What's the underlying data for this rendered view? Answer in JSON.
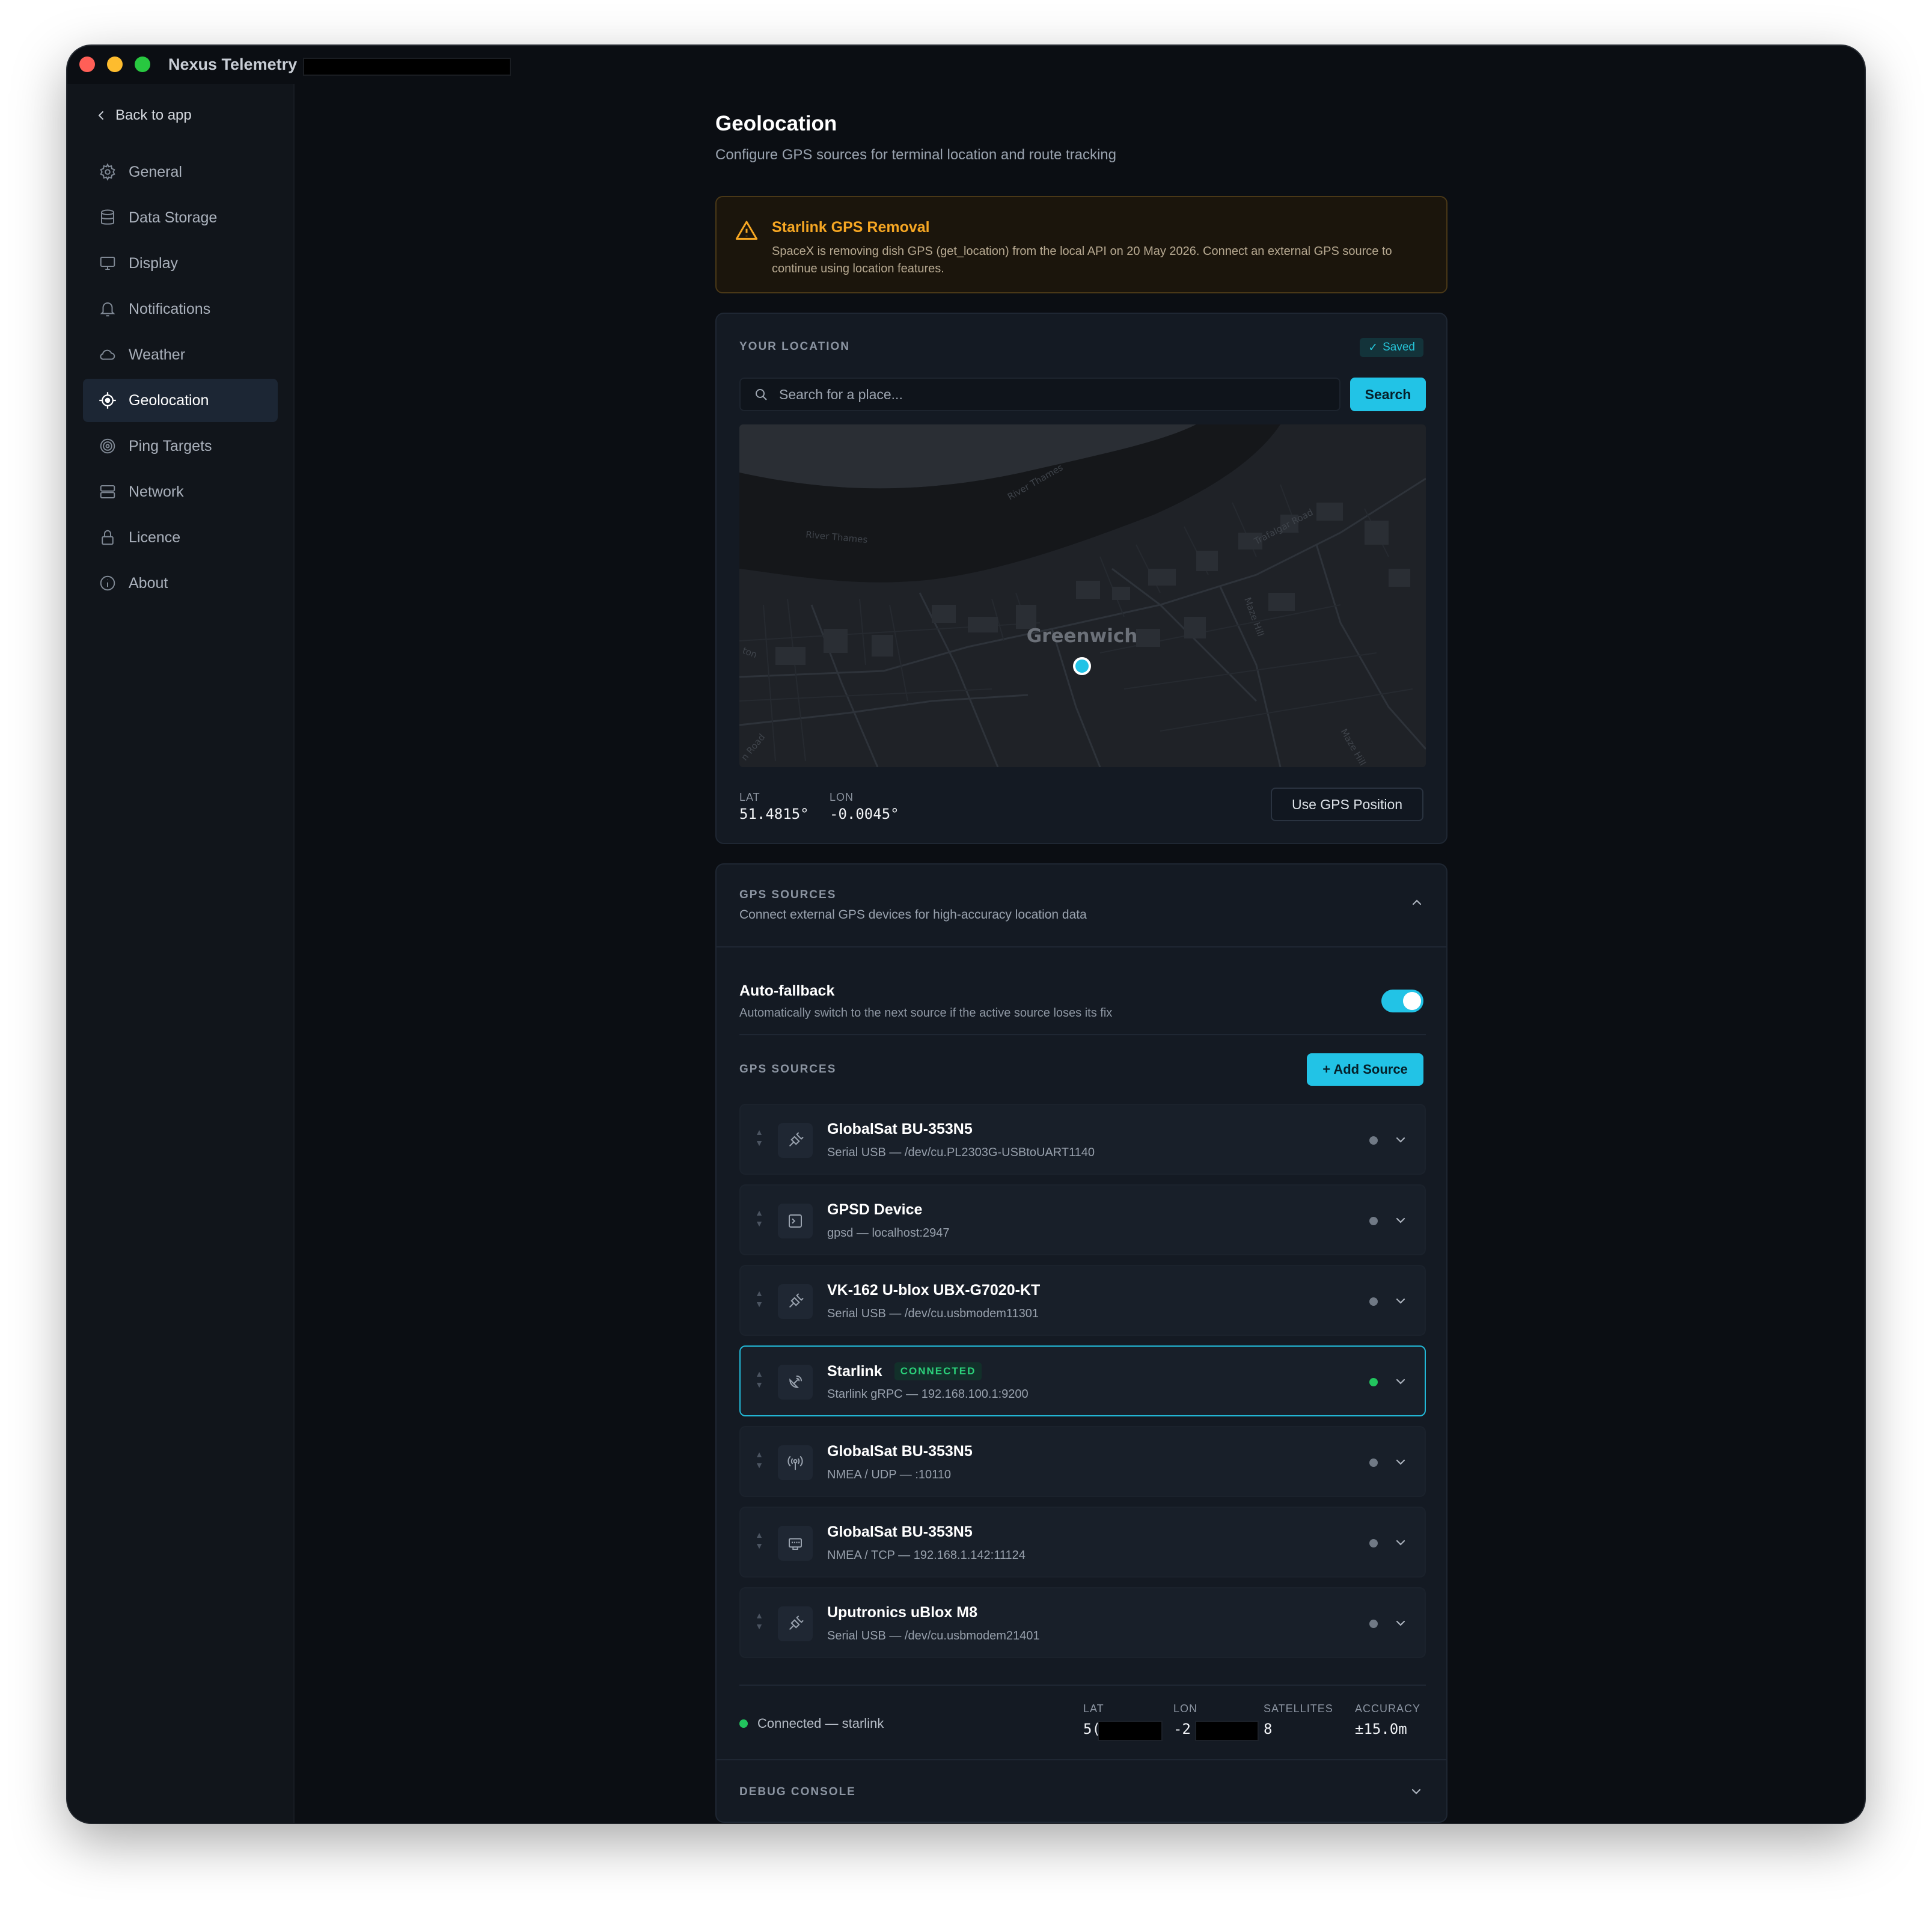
{
  "window": {
    "title": "Nexus Telemetry"
  },
  "sidebar": {
    "back_label": "Back to app",
    "items": [
      {
        "label": "General",
        "icon": "gear-icon"
      },
      {
        "label": "Data Storage",
        "icon": "database-icon"
      },
      {
        "label": "Display",
        "icon": "monitor-icon"
      },
      {
        "label": "Notifications",
        "icon": "bell-icon"
      },
      {
        "label": "Weather",
        "icon": "cloud-icon"
      },
      {
        "label": "Geolocation",
        "icon": "crosshair-icon",
        "active": true
      },
      {
        "label": "Ping Targets",
        "icon": "target-icon"
      },
      {
        "label": "Network",
        "icon": "server-icon"
      },
      {
        "label": "Licence",
        "icon": "lock-icon"
      },
      {
        "label": "About",
        "icon": "info-icon"
      }
    ]
  },
  "page": {
    "title": "Geolocation",
    "subtitle": "Configure GPS sources for terminal location and route tracking"
  },
  "alert": {
    "title": "Starlink GPS Removal",
    "text": "SpaceX is removing dish GPS (get_location) from the local API on 20 May 2026. Connect an external GPS source to continue using location features."
  },
  "location": {
    "heading": "YOUR LOCATION",
    "saved_label": "Saved",
    "search_placeholder": "Search for a place...",
    "search_button": "Search",
    "map": {
      "place_label": "Greenwich",
      "labels": [
        "River Thames",
        "River Thames",
        "Trafalgar Road",
        "Maze Hill",
        "Maze Hill",
        "ton",
        "n Road"
      ]
    },
    "lat_label": "LAT",
    "lat_value": "51.4815°",
    "lon_label": "LON",
    "lon_value": "-0.0045°",
    "gps_button": "Use GPS Position"
  },
  "gps": {
    "heading": "GPS SOURCES",
    "subtitle": "Connect external GPS devices for high-accuracy location data",
    "autofallback_title": "Auto-fallback",
    "autofallback_desc": "Automatically switch to the next source if the active source loses its fix",
    "autofallback_on": true,
    "list_heading": "GPS SOURCES",
    "add_button": "+ Add Source",
    "sources": [
      {
        "name": "GlobalSat BU-353N5",
        "detail": "Serial USB — /dev/cu.PL2303G-USBtoUART1140",
        "icon": "usb-plug-icon",
        "badge": "",
        "connected": false
      },
      {
        "name": "GPSD Device",
        "detail": "gpsd — localhost:2947",
        "icon": "terminal-icon",
        "badge": "",
        "connected": false
      },
      {
        "name": "VK-162 U-blox UBX-G7020-KT",
        "detail": "Serial USB — /dev/cu.usbmodem11301",
        "icon": "usb-plug-icon",
        "badge": "",
        "connected": false
      },
      {
        "name": "Starlink",
        "detail": "Starlink gRPC — 192.168.100.1:9200",
        "icon": "satellite-dish-icon",
        "badge": "CONNECTED",
        "connected": true
      },
      {
        "name": "GlobalSat BU-353N5",
        "detail": "NMEA / UDP — :10110",
        "icon": "radio-tower-icon",
        "badge": "",
        "connected": false
      },
      {
        "name": "GlobalSat BU-353N5",
        "detail": "NMEA / TCP — 192.168.1.142:11124",
        "icon": "ethernet-icon",
        "badge": "",
        "connected": false
      },
      {
        "name": "Uputronics uBlox M8",
        "detail": "Serial USB — /dev/cu.usbmodem21401",
        "icon": "usb-plug-icon",
        "badge": "",
        "connected": false
      }
    ],
    "status_text": "Connected — starlink",
    "lat_label": "LAT",
    "lat_value": "5(",
    "lon_label": "LON",
    "lon_value": "-2",
    "satellites_label": "SATELLITES",
    "satellites_value": "8",
    "accuracy_label": "ACCURACY",
    "accuracy_value": "±15.0m",
    "debug_label": "DEBUG CONSOLE"
  },
  "colors": {
    "accent": "#22c3e6",
    "warning": "#f5a623",
    "success": "#22c55e"
  }
}
